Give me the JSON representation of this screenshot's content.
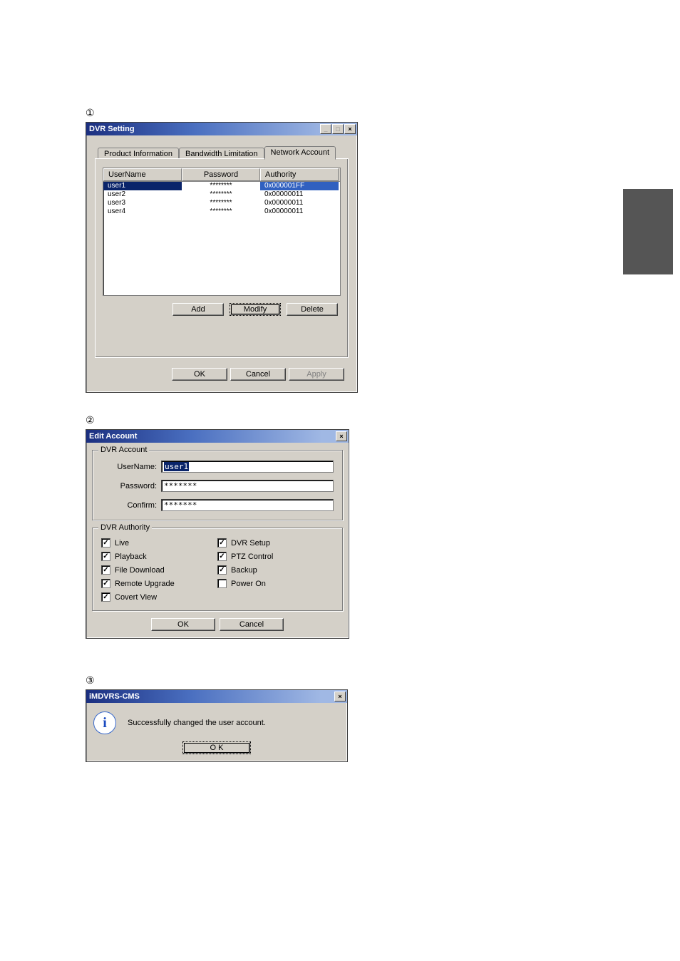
{
  "markers": {
    "one": "①",
    "two": "②",
    "three": "③"
  },
  "win1": {
    "title": "DVR Setting",
    "tabs": {
      "product": "Product Information",
      "bandwidth": "Bandwidth Limitation",
      "network": "Network Account"
    },
    "cols": {
      "user": "UserName",
      "pass": "Password",
      "auth": "Authority"
    },
    "rows": [
      {
        "u": "user1",
        "p": "********",
        "a": "0x000001FF"
      },
      {
        "u": "user2",
        "p": "********",
        "a": "0x00000011"
      },
      {
        "u": "user3",
        "p": "********",
        "a": "0x00000011"
      },
      {
        "u": "user4",
        "p": "********",
        "a": "0x00000011"
      }
    ],
    "btns": {
      "add": "Add",
      "modify": "Modify",
      "delete": "Delete",
      "ok": "OK",
      "cancel": "Cancel",
      "apply": "Apply"
    }
  },
  "win2": {
    "title": "Edit Account",
    "group1": "DVR Account",
    "labels": {
      "user": "UserName:",
      "pass": "Password:",
      "confirm": "Confirm:"
    },
    "values": {
      "user": "user1",
      "pass": "*******",
      "confirm": "*******"
    },
    "group2": "DVR Authority",
    "checks": {
      "live": "Live",
      "dvrsetup": "DVR Setup",
      "playback": "Playback",
      "ptz": "PTZ Control",
      "filedl": "File Download",
      "backup": "Backup",
      "remote": "Remote Upgrade",
      "poweron": "Power On",
      "covert": "Covert View"
    },
    "btns": {
      "ok": "OK",
      "cancel": "Cancel"
    }
  },
  "win3": {
    "title": "iMDVRS-CMS",
    "message": "Successfully changed the user account.",
    "ok": "O K"
  },
  "tb": {
    "min": "_",
    "max": "□",
    "close": "×"
  }
}
